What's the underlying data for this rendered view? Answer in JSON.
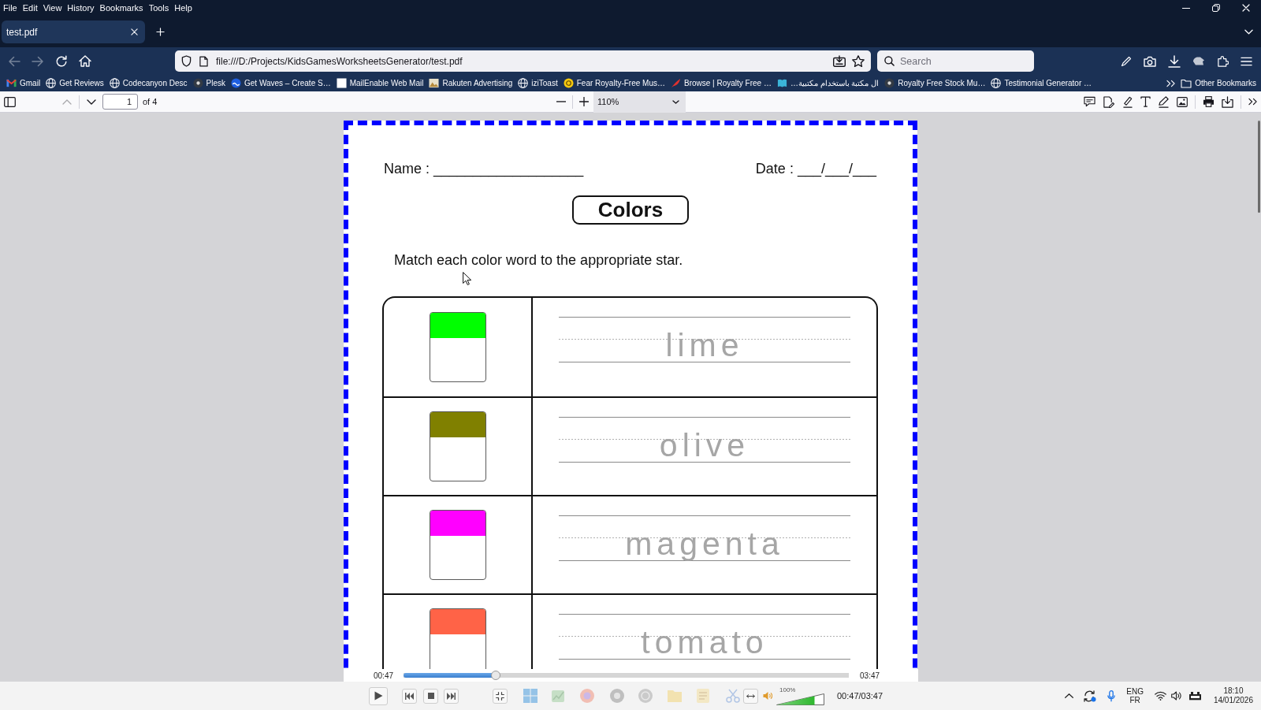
{
  "menu_bar": [
    "File",
    "Edit",
    "View",
    "History",
    "Bookmarks",
    "Tools",
    "Help"
  ],
  "tabs": [
    {
      "label": "test.pdf",
      "selected": true
    }
  ],
  "nav_buttons": [
    {
      "kind": "back",
      "disabled": true
    },
    {
      "kind": "forward",
      "disabled": true
    },
    {
      "kind": "reload",
      "disabled": false
    },
    {
      "kind": "home",
      "disabled": false
    }
  ],
  "address_bar": {
    "url": "file:///D:/Projects/KidsGamesWorksheetsGenerator/test.pdf"
  },
  "search": {
    "placeholder": "Search"
  },
  "bookmarks": [
    {
      "label": "Gmail",
      "kind": "mail"
    },
    {
      "label": "Get Reviews",
      "kind": "globe"
    },
    {
      "label": "Codecanyon Desc",
      "kind": "globe"
    },
    {
      "label": "Plesk",
      "kind": "round"
    },
    {
      "label": "Get Waves – Create S…",
      "kind": "wave"
    },
    {
      "label": "MailEnable Web Mail",
      "kind": "blank"
    },
    {
      "label": "Rakuten Advertising",
      "kind": "picture"
    },
    {
      "label": "iziToast",
      "kind": "globe"
    },
    {
      "label": "Fear Royalty-Free Mus…",
      "kind": "coin"
    },
    {
      "label": "Browse | Royalty Free …",
      "kind": "feather"
    },
    {
      "label": "ال مكتبة باستخدام مكتبية…",
      "kind": "book"
    },
    {
      "label": "Royalty Free Stock Mu…",
      "kind": "round"
    },
    {
      "label": "Testimonial Generator …",
      "kind": "globe"
    }
  ],
  "other_bookmarks": "Other Bookmarks",
  "pdf_toolbar": {
    "page_buttons": [
      {
        "kind": "previous",
        "disabled": true
      },
      {
        "kind": "next",
        "disabled": false
      }
    ],
    "page": "1",
    "page_count": "of 4",
    "zoom": "110%"
  },
  "worksheet": {
    "name": {
      "label": "Name :",
      "blank": "___________________"
    },
    "date": {
      "label": "Date :",
      "blank": "___/___/___"
    },
    "title": "Colors",
    "instruction": "Match each color word to the appropriate star.",
    "rows": [
      {
        "word": "lime",
        "color": "#00ff00"
      },
      {
        "word": "olive",
        "color": "#808000"
      },
      {
        "word": "magenta",
        "color": "#ff00ff"
      },
      {
        "word": "tomato",
        "color": "#ff6347"
      }
    ]
  },
  "player": {
    "seek": {
      "elapsed": "00:47",
      "duration": "03:47",
      "level": 0.207
    },
    "volume": {
      "reading": "100%",
      "level": 0.8
    },
    "time_display": "00:47/03:47"
  },
  "taskbar": {
    "language": "ENG",
    "layout": "FR",
    "time": "18:10",
    "date": "14/01/2026"
  }
}
